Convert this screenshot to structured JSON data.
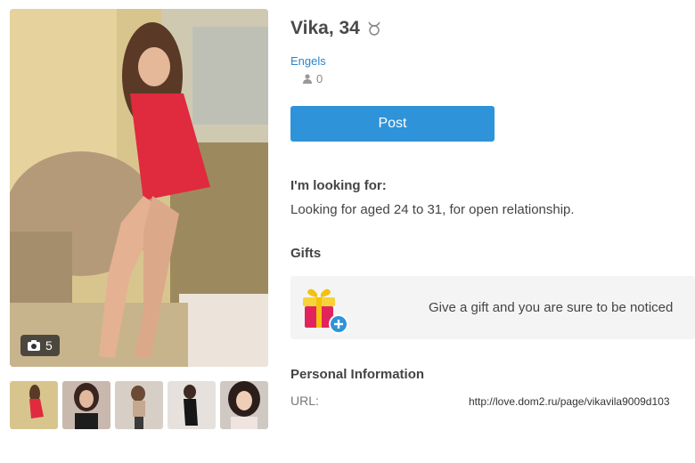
{
  "profile": {
    "name_age": "Vika, 34",
    "zodiac_icon": "taurus-icon",
    "city": "Engels",
    "friends_count": "0",
    "photo_count": "5"
  },
  "actions": {
    "post_label": "Post"
  },
  "looking_for": {
    "heading": "I'm looking for:",
    "text": "Looking for aged 24 to 31, for open relationship."
  },
  "gifts": {
    "heading": "Gifts",
    "prompt": "Give a gift and you are sure to be noticed"
  },
  "personal_info": {
    "heading": "Personal Information",
    "rows": [
      {
        "label": "URL:",
        "value": "http://love.dom2.ru/page/vikavila9009d103"
      }
    ]
  },
  "colors": {
    "accent": "#2e93d9",
    "link": "#2c85c9",
    "gift_bg": "#f4f4f4"
  }
}
